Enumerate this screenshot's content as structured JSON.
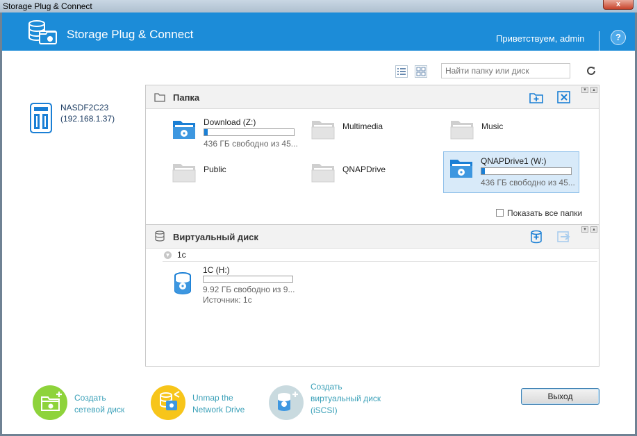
{
  "window": {
    "title": "Storage Plug & Connect",
    "close_glyph": "x"
  },
  "header": {
    "app_name": "Storage Plug & Connect",
    "welcome": "Приветствуем, admin",
    "help_glyph": "?",
    "accent": "#1c8cd8"
  },
  "toolbar": {
    "search_placeholder": "Найти папку или диск"
  },
  "nas": {
    "name": "NASDF2C23",
    "ip": "(192.168.1.37)"
  },
  "folders_panel": {
    "title": "Папка",
    "items": [
      {
        "name": "Download (Z:)",
        "space": "436 ГБ свободно из 45...",
        "usage": 0.04,
        "mapped": true,
        "selected": false
      },
      {
        "name": "Multimedia",
        "space": "",
        "usage": null,
        "mapped": false,
        "selected": false
      },
      {
        "name": "Music",
        "space": "",
        "usage": null,
        "mapped": false,
        "selected": false
      },
      {
        "name": "Public",
        "space": "",
        "usage": null,
        "mapped": false,
        "selected": false
      },
      {
        "name": "QNAPDrive",
        "space": "",
        "usage": null,
        "mapped": false,
        "selected": false
      },
      {
        "name": "QNAPDrive1 (W:)",
        "space": "436 ГБ свободно из 45...",
        "usage": 0.04,
        "mapped": true,
        "selected": true
      }
    ],
    "show_all_label": "Показать все папки",
    "show_all_checked": false
  },
  "virtual_panel": {
    "title": "Виртуальный диск",
    "group": "1c",
    "disks": [
      {
        "name": "1C (H:)",
        "space": "9.92 ГБ свободно из 9...",
        "source": "Источник: 1c",
        "usage": 0.0
      }
    ]
  },
  "actions": {
    "create_network_drive": [
      "Создать",
      "сетевой диск"
    ],
    "unmap_network_drive": [
      "Unmap the",
      "Network Drive"
    ],
    "create_virtual_disk": [
      "Создать",
      "виртуальный диск",
      "(iSCSI)"
    ],
    "colors": {
      "green": "#8ed33b",
      "yellow": "#f7c51a",
      "grey": "#c9dadf"
    }
  },
  "exit_label": "Выход"
}
